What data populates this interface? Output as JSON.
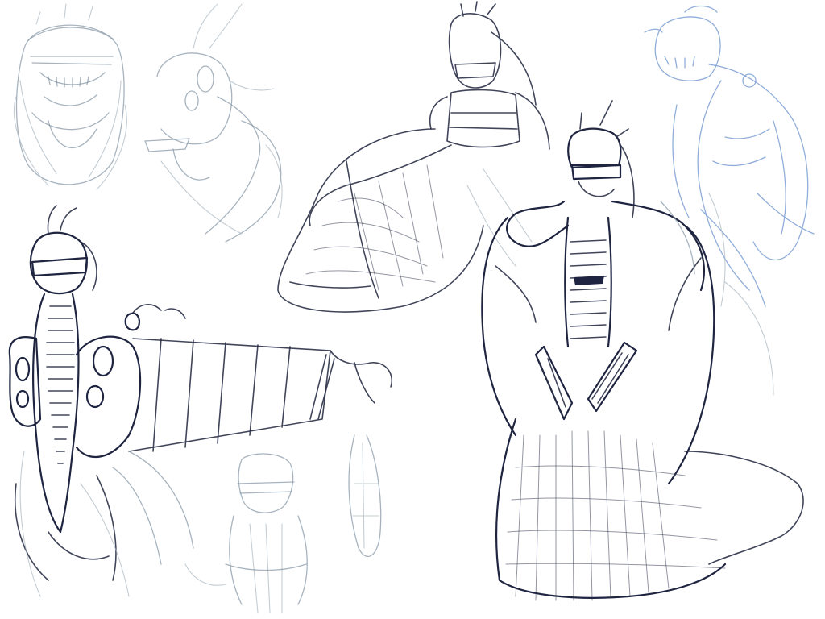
{
  "colors": {
    "background": "#ffffff",
    "pencil_grey": "#8a9aa8",
    "pencil_light": "#a9b6c0",
    "ink_dark": "#2b3148",
    "ink_navy": "#1f2540",
    "pencil_blue": "#7d9fd2"
  }
}
